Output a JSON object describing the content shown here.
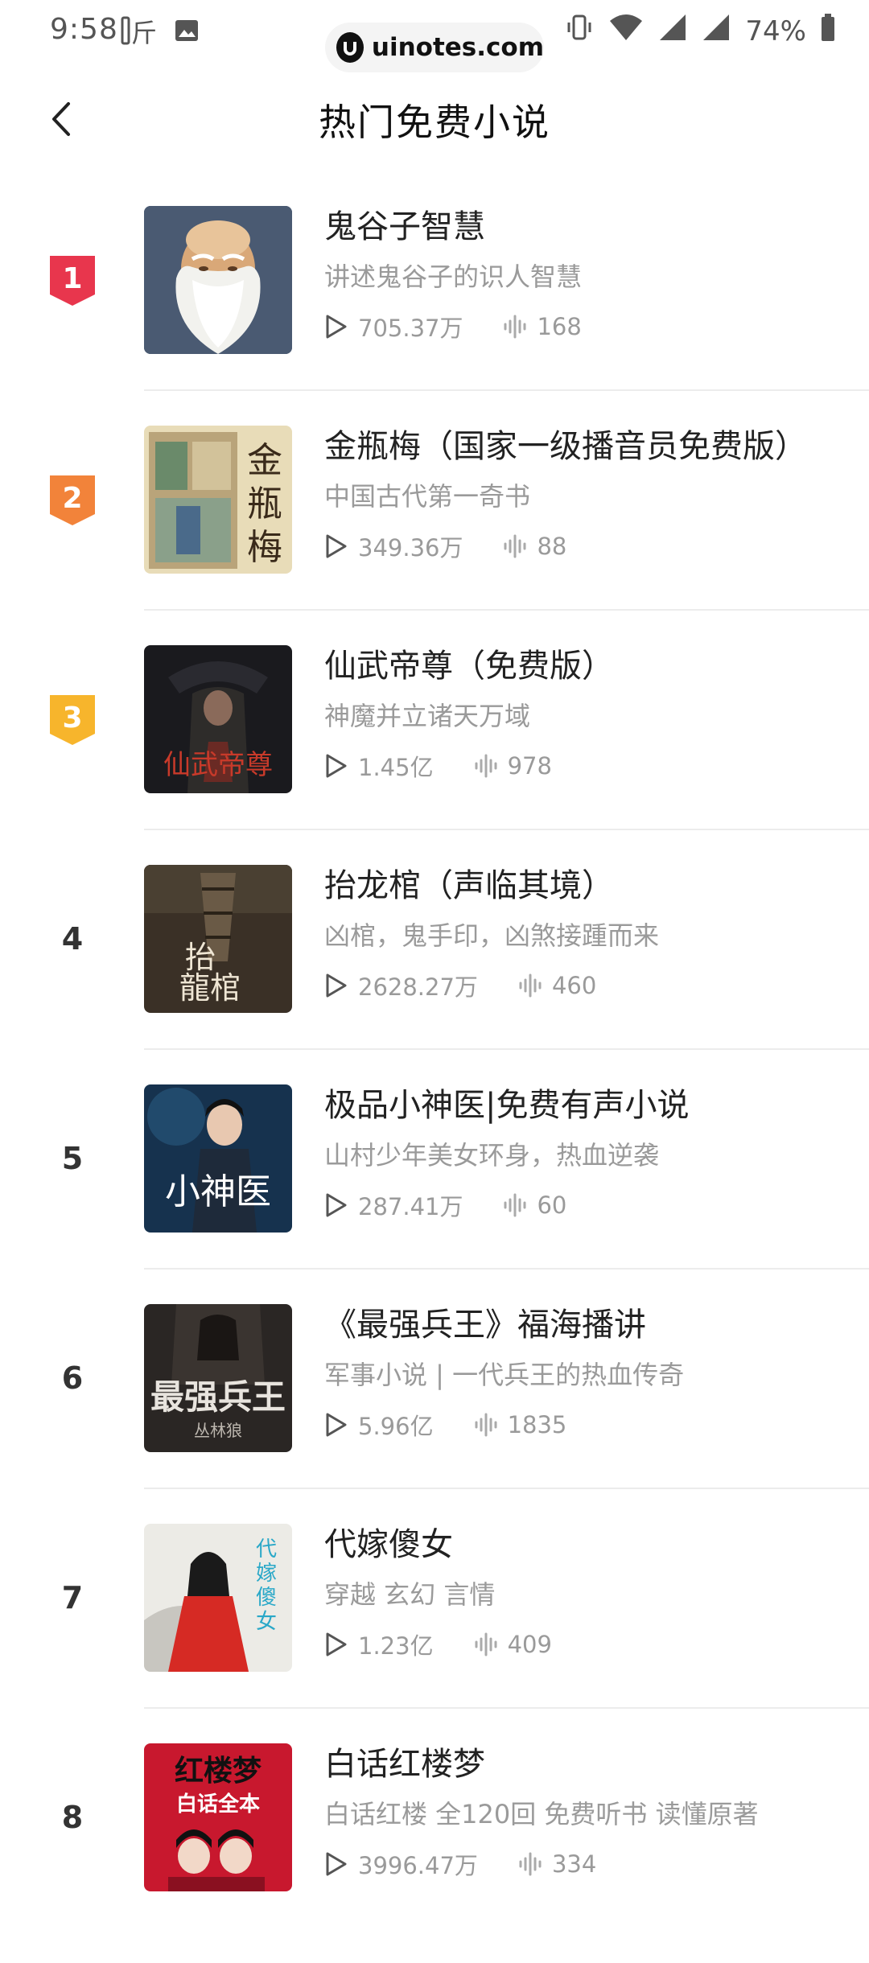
{
  "status_bar": {
    "time": "9:58",
    "battery": "74%",
    "watermark": "uinotes.com"
  },
  "header": {
    "title": "热门免费小说"
  },
  "colors": {
    "rank1": "#e8364d",
    "rank2": "#f2833a",
    "rank3": "#f7b52c"
  },
  "items": [
    {
      "rank": "1",
      "title": "鬼谷子智慧",
      "desc": "讲述鬼谷子的识人智慧",
      "plays": "705.37万",
      "tracks": "168"
    },
    {
      "rank": "2",
      "title": "金瓶梅（国家一级播音员免费版）",
      "desc": "中国古代第一奇书",
      "plays": "349.36万",
      "tracks": "88"
    },
    {
      "rank": "3",
      "title": "仙武帝尊（免费版）",
      "desc": "神魔并立诸天万域",
      "plays": "1.45亿",
      "tracks": "978"
    },
    {
      "rank": "4",
      "title": "抬龙棺（声临其境）",
      "desc": "凶棺，鬼手印，凶煞接踵而来",
      "plays": "2628.27万",
      "tracks": "460"
    },
    {
      "rank": "5",
      "title": "极品小神医|免费有声小说",
      "desc": "山村少年美女环身，热血逆袭",
      "plays": "287.41万",
      "tracks": "60"
    },
    {
      "rank": "6",
      "title": "《最强兵王》福海播讲",
      "desc": "军事小说 | 一代兵王的热血传奇",
      "plays": "5.96亿",
      "tracks": "1835"
    },
    {
      "rank": "7",
      "title": "代嫁傻女",
      "desc": "穿越 玄幻 言情",
      "plays": "1.23亿",
      "tracks": "409"
    },
    {
      "rank": "8",
      "title": "白话红楼梦",
      "desc": "白话红楼 全120回 免费听书 读懂原著",
      "plays": "3996.47万",
      "tracks": "334"
    }
  ]
}
